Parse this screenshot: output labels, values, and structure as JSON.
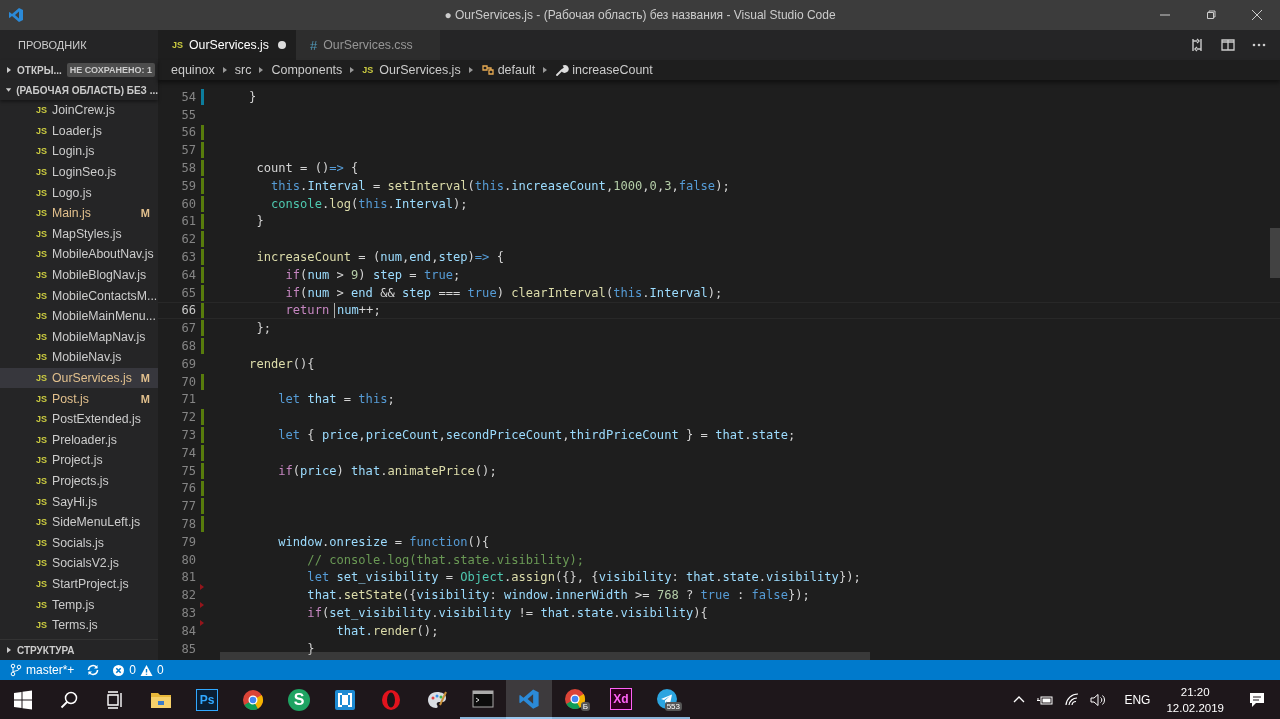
{
  "window": {
    "title": "● OurServices.js - (Рабочая область) без названия - Visual Studio Code"
  },
  "sidebar": {
    "title": "ПРОВОДНИК",
    "open_editors": {
      "label": "ОТКРЫ...",
      "badge": "НЕ СОХРАНЕНО: 1",
      "expanded": false
    },
    "workspace": {
      "label": "(РАБОЧАЯ ОБЛАСТЬ) БЕЗ ...",
      "expanded": true
    },
    "files": [
      {
        "icon": "JS",
        "name": "JoinCrew.js",
        "selected": false
      },
      {
        "icon": "JS",
        "name": "Loader.js",
        "selected": false
      },
      {
        "icon": "JS",
        "name": "Login.js",
        "selected": false
      },
      {
        "icon": "JS",
        "name": "LoginSeo.js",
        "selected": false
      },
      {
        "icon": "JS",
        "name": "Logo.js",
        "selected": false
      },
      {
        "icon": "JS",
        "name": "Main.js",
        "selected": false,
        "badge": "M"
      },
      {
        "icon": "JS",
        "name": "MapStyles.js",
        "selected": false
      },
      {
        "icon": "JS",
        "name": "MobileAboutNav.js",
        "selected": false
      },
      {
        "icon": "JS",
        "name": "MobileBlogNav.js",
        "selected": false
      },
      {
        "icon": "JS",
        "name": "MobileContactsM...",
        "selected": false
      },
      {
        "icon": "JS",
        "name": "MobileMainMenu...",
        "selected": false
      },
      {
        "icon": "JS",
        "name": "MobileMapNav.js",
        "selected": false
      },
      {
        "icon": "JS",
        "name": "MobileNav.js",
        "selected": false
      },
      {
        "icon": "JS",
        "name": "OurServices.js",
        "selected": true,
        "badge": "M"
      },
      {
        "icon": "JS",
        "name": "Post.js",
        "selected": false,
        "badge": "M"
      },
      {
        "icon": "JS",
        "name": "PostExtended.js",
        "selected": false
      },
      {
        "icon": "JS",
        "name": "Preloader.js",
        "selected": false
      },
      {
        "icon": "JS",
        "name": "Project.js",
        "selected": false
      },
      {
        "icon": "JS",
        "name": "Projects.js",
        "selected": false
      },
      {
        "icon": "JS",
        "name": "SayHi.js",
        "selected": false
      },
      {
        "icon": "JS",
        "name": "SideMenuLeft.js",
        "selected": false
      },
      {
        "icon": "JS",
        "name": "Socials.js",
        "selected": false
      },
      {
        "icon": "JS",
        "name": "SocialsV2.js",
        "selected": false
      },
      {
        "icon": "JS",
        "name": "StartProject.js",
        "selected": false
      },
      {
        "icon": "JS",
        "name": "Temp.js",
        "selected": false
      },
      {
        "icon": "JS",
        "name": "Terms.js",
        "selected": false
      }
    ],
    "outline": {
      "label": "СТРУКТУРА",
      "expanded": false
    }
  },
  "tabs": [
    {
      "icon": "JS",
      "label": "OurServices.js",
      "selected": true,
      "dirty": true
    },
    {
      "icon": "#",
      "label": "OurServices.css",
      "selected": false,
      "dirty": false
    }
  ],
  "breadcrumb": [
    {
      "kind": "folder",
      "text": "equinox"
    },
    {
      "kind": "folder",
      "text": "src"
    },
    {
      "kind": "folder",
      "text": "Components"
    },
    {
      "kind": "file",
      "icon": "JS",
      "text": "OurServices.js"
    },
    {
      "kind": "class",
      "text": "default"
    },
    {
      "kind": "method",
      "text": "increaseCount"
    }
  ],
  "editor": {
    "lines": [
      {
        "n": "54",
        "kind": "modified",
        "tokens": [
          {
            "t": "    }",
            "kind": "plain"
          }
        ]
      },
      {
        "n": "55",
        "kind": "plain"
      },
      {
        "n": "56",
        "kind": "added"
      },
      {
        "n": "57",
        "kind": "added"
      },
      {
        "n": "58",
        "kind": "added",
        "tokens": [
          {
            "t": "     count = ()",
            "kind": "plain"
          },
          {
            "t": "=>",
            "kind": "storage"
          },
          {
            "t": " {",
            "kind": "plain"
          }
        ]
      },
      {
        "n": "59",
        "kind": "added",
        "tokens": [
          {
            "t": "       this",
            "kind": "storage"
          },
          {
            "t": ".",
            "kind": "plain"
          },
          {
            "t": "Interval",
            "kind": "variable"
          },
          {
            "t": " = ",
            "kind": "plain"
          },
          {
            "t": "setInterval",
            "kind": "function"
          },
          {
            "t": "(",
            "kind": "plain"
          },
          {
            "t": "this",
            "kind": "storage"
          },
          {
            "t": ".",
            "kind": "plain"
          },
          {
            "t": "increaseCount",
            "kind": "variable"
          },
          {
            "t": ",",
            "kind": "plain"
          },
          {
            "t": "1000",
            "kind": "number"
          },
          {
            "t": ",",
            "kind": "plain"
          },
          {
            "t": "0",
            "kind": "number"
          },
          {
            "t": ",",
            "kind": "plain"
          },
          {
            "t": "3",
            "kind": "number"
          },
          {
            "t": ",",
            "kind": "plain"
          },
          {
            "t": "false",
            "kind": "storage"
          },
          {
            "t": ");",
            "kind": "plain"
          }
        ]
      },
      {
        "n": "60",
        "kind": "added",
        "tokens": [
          {
            "t": "       console",
            "kind": "type"
          },
          {
            "t": ".",
            "kind": "plain"
          },
          {
            "t": "log",
            "kind": "function"
          },
          {
            "t": "(",
            "kind": "plain"
          },
          {
            "t": "this",
            "kind": "storage"
          },
          {
            "t": ".",
            "kind": "plain"
          },
          {
            "t": "Interval",
            "kind": "variable"
          },
          {
            "t": ");",
            "kind": "plain"
          }
        ]
      },
      {
        "n": "61",
        "kind": "added",
        "tokens": [
          {
            "t": "     }",
            "kind": "plain"
          }
        ]
      },
      {
        "n": "62",
        "kind": "added"
      },
      {
        "n": "63",
        "kind": "added",
        "tokens": [
          {
            "t": "     increaseCount",
            "kind": "function"
          },
          {
            "t": " = (",
            "kind": "plain"
          },
          {
            "t": "num",
            "kind": "variable"
          },
          {
            "t": ",",
            "kind": "plain"
          },
          {
            "t": "end",
            "kind": "variable"
          },
          {
            "t": ",",
            "kind": "plain"
          },
          {
            "t": "step",
            "kind": "variable"
          },
          {
            "t": ")",
            "kind": "plain"
          },
          {
            "t": "=>",
            "kind": "storage"
          },
          {
            "t": " {",
            "kind": "plain"
          }
        ]
      },
      {
        "n": "64",
        "kind": "added",
        "tokens": [
          {
            "t": "         if",
            "kind": "keyword"
          },
          {
            "t": "(",
            "kind": "plain"
          },
          {
            "t": "num",
            "kind": "variable"
          },
          {
            "t": " > ",
            "kind": "plain"
          },
          {
            "t": "9",
            "kind": "number"
          },
          {
            "t": ") ",
            "kind": "plain"
          },
          {
            "t": "step",
            "kind": "variable"
          },
          {
            "t": " = ",
            "kind": "plain"
          },
          {
            "t": "true",
            "kind": "storage"
          },
          {
            "t": ";",
            "kind": "plain"
          }
        ]
      },
      {
        "n": "65",
        "kind": "added",
        "tokens": [
          {
            "t": "         if",
            "kind": "keyword"
          },
          {
            "t": "(",
            "kind": "plain"
          },
          {
            "t": "num",
            "kind": "variable"
          },
          {
            "t": " > ",
            "kind": "plain"
          },
          {
            "t": "end",
            "kind": "variable"
          },
          {
            "t": " && ",
            "kind": "plain"
          },
          {
            "t": "step",
            "kind": "variable"
          },
          {
            "t": " === ",
            "kind": "plain"
          },
          {
            "t": "true",
            "kind": "storage"
          },
          {
            "t": ") ",
            "kind": "plain"
          },
          {
            "t": "clearInterval",
            "kind": "function"
          },
          {
            "t": "(",
            "kind": "plain"
          },
          {
            "t": "this",
            "kind": "storage"
          },
          {
            "t": ".",
            "kind": "plain"
          },
          {
            "t": "Interval",
            "kind": "variable"
          },
          {
            "t": ");",
            "kind": "plain"
          }
        ]
      },
      {
        "n": "66",
        "kind": "added",
        "current": true,
        "tokens": [
          {
            "t": "         return ",
            "kind": "keyword"
          },
          {
            "kind": "cursor"
          },
          {
            "t": "num",
            "kind": "variable"
          },
          {
            "t": "++;",
            "kind": "plain"
          }
        ]
      },
      {
        "n": "67",
        "kind": "added",
        "tokens": [
          {
            "t": "     };",
            "kind": "plain"
          }
        ]
      },
      {
        "n": "68",
        "kind": "added"
      },
      {
        "n": "69",
        "kind": "plain",
        "tokens": [
          {
            "t": "    render",
            "kind": "function"
          },
          {
            "t": "(){",
            "kind": "plain"
          }
        ]
      },
      {
        "n": "70",
        "kind": "added"
      },
      {
        "n": "71",
        "kind": "plain",
        "tokens": [
          {
            "t": "        let ",
            "kind": "storage"
          },
          {
            "t": "that",
            "kind": "variable"
          },
          {
            "t": " = ",
            "kind": "plain"
          },
          {
            "t": "this",
            "kind": "storage"
          },
          {
            "t": ";",
            "kind": "plain"
          }
        ]
      },
      {
        "n": "72",
        "kind": "added"
      },
      {
        "n": "73",
        "kind": "added",
        "tokens": [
          {
            "t": "        let",
            "kind": "storage"
          },
          {
            "t": " { ",
            "kind": "plain"
          },
          {
            "t": "price",
            "kind": "variable"
          },
          {
            "t": ",",
            "kind": "plain"
          },
          {
            "t": "priceCount",
            "kind": "variable"
          },
          {
            "t": ",",
            "kind": "plain"
          },
          {
            "t": "secondPriceCount",
            "kind": "variable"
          },
          {
            "t": ",",
            "kind": "plain"
          },
          {
            "t": "thirdPriceCount",
            "kind": "variable"
          },
          {
            "t": " } = ",
            "kind": "plain"
          },
          {
            "t": "that",
            "kind": "variable"
          },
          {
            "t": ".",
            "kind": "plain"
          },
          {
            "t": "state",
            "kind": "variable"
          },
          {
            "t": ";",
            "kind": "plain"
          }
        ]
      },
      {
        "n": "74",
        "kind": "added"
      },
      {
        "n": "75",
        "kind": "added",
        "tokens": [
          {
            "t": "        if",
            "kind": "keyword"
          },
          {
            "t": "(",
            "kind": "plain"
          },
          {
            "t": "price",
            "kind": "variable"
          },
          {
            "t": ") ",
            "kind": "plain"
          },
          {
            "t": "that",
            "kind": "variable"
          },
          {
            "t": ".",
            "kind": "plain"
          },
          {
            "t": "animatePrice",
            "kind": "function"
          },
          {
            "t": "();",
            "kind": "plain"
          }
        ]
      },
      {
        "n": "76",
        "kind": "added"
      },
      {
        "n": "77",
        "kind": "added"
      },
      {
        "n": "78",
        "kind": "added"
      },
      {
        "n": "79",
        "kind": "plain",
        "tokens": [
          {
            "t": "        window",
            "kind": "variable"
          },
          {
            "t": ".",
            "kind": "plain"
          },
          {
            "t": "onresize",
            "kind": "variable"
          },
          {
            "t": " = ",
            "kind": "plain"
          },
          {
            "t": "function",
            "kind": "storage"
          },
          {
            "t": "(){",
            "kind": "plain"
          }
        ]
      },
      {
        "n": "80",
        "kind": "plain",
        "tokens": [
          {
            "t": "            // console.log(that.state.visibility);",
            "kind": "comment"
          }
        ]
      },
      {
        "n": "81",
        "kind": "plain",
        "tokens": [
          {
            "t": "            let ",
            "kind": "storage"
          },
          {
            "t": "set_visibility",
            "kind": "variable"
          },
          {
            "t": " = ",
            "kind": "plain"
          },
          {
            "t": "Object",
            "kind": "type"
          },
          {
            "t": ".",
            "kind": "plain"
          },
          {
            "t": "assign",
            "kind": "function"
          },
          {
            "t": "({}, {",
            "kind": "plain"
          },
          {
            "t": "visibility",
            "kind": "variable"
          },
          {
            "t": ": ",
            "kind": "plain"
          },
          {
            "t": "that",
            "kind": "variable"
          },
          {
            "t": ".",
            "kind": "plain"
          },
          {
            "t": "state",
            "kind": "variable"
          },
          {
            "t": ".",
            "kind": "plain"
          },
          {
            "t": "visibility",
            "kind": "variable"
          },
          {
            "t": "});",
            "kind": "plain"
          }
        ]
      },
      {
        "n": "82",
        "kind": "deleted",
        "tokens": [
          {
            "t": "            that",
            "kind": "variable"
          },
          {
            "t": ".",
            "kind": "plain"
          },
          {
            "t": "setState",
            "kind": "function"
          },
          {
            "t": "({",
            "kind": "plain"
          },
          {
            "t": "visibility",
            "kind": "variable"
          },
          {
            "t": ": ",
            "kind": "plain"
          },
          {
            "t": "window",
            "kind": "variable"
          },
          {
            "t": ".",
            "kind": "plain"
          },
          {
            "t": "innerWidth",
            "kind": "variable"
          },
          {
            "t": " >= ",
            "kind": "plain"
          },
          {
            "t": "768",
            "kind": "number"
          },
          {
            "t": " ? ",
            "kind": "plain"
          },
          {
            "t": "true",
            "kind": "storage"
          },
          {
            "t": " : ",
            "kind": "plain"
          },
          {
            "t": "false",
            "kind": "storage"
          },
          {
            "t": "});",
            "kind": "plain"
          }
        ]
      },
      {
        "n": "83",
        "kind": "deleted",
        "tokens": [
          {
            "t": "            if",
            "kind": "keyword"
          },
          {
            "t": "(",
            "kind": "plain"
          },
          {
            "t": "set_visibility",
            "kind": "variable"
          },
          {
            "t": ".",
            "kind": "plain"
          },
          {
            "t": "visibility",
            "kind": "variable"
          },
          {
            "t": " != ",
            "kind": "plain"
          },
          {
            "t": "that",
            "kind": "variable"
          },
          {
            "t": ".",
            "kind": "plain"
          },
          {
            "t": "state",
            "kind": "variable"
          },
          {
            "t": ".",
            "kind": "plain"
          },
          {
            "t": "visibility",
            "kind": "variable"
          },
          {
            "t": "){",
            "kind": "plain"
          }
        ]
      },
      {
        "n": "84",
        "kind": "deleted",
        "tokens": [
          {
            "t": "                that.",
            "kind": "variable"
          },
          {
            "t": "render",
            "kind": "function"
          },
          {
            "t": "();",
            "kind": "plain"
          }
        ]
      },
      {
        "n": "85",
        "kind": "plain",
        "tokens": [
          {
            "t": "            }",
            "kind": "plain"
          }
        ]
      }
    ]
  },
  "status_bar": {
    "branch": "master*+",
    "errors": "0",
    "warnings": "0"
  },
  "taskbar": {
    "apps": [
      {
        "kind": "start",
        "running": false,
        "active": false
      },
      {
        "kind": "search",
        "running": false,
        "active": false
      },
      {
        "kind": "taskview",
        "running": false,
        "active": false
      },
      {
        "kind": "folder",
        "running": false,
        "active": false
      },
      {
        "kind": "ps",
        "text": "Ps",
        "running": false,
        "active": false
      },
      {
        "kind": "chrome",
        "running": false,
        "active": false
      },
      {
        "kind": "s",
        "text": "S",
        "running": false,
        "active": false
      },
      {
        "kind": "brackets",
        "running": false,
        "active": false
      },
      {
        "kind": "opera",
        "running": false,
        "active": false
      },
      {
        "kind": "paint",
        "running": false,
        "active": false
      },
      {
        "kind": "terminal",
        "running": true,
        "active": false
      },
      {
        "kind": "vscode",
        "running": true,
        "active": true
      },
      {
        "kind": "chrome",
        "badge": "Б",
        "running": true,
        "active": false
      },
      {
        "kind": "xd",
        "text": "Xd",
        "running": true,
        "active": false
      },
      {
        "kind": "telegram",
        "badge": "553",
        "running": true,
        "active": false
      }
    ],
    "language": "ENG",
    "time": "21:20",
    "date": "12.02.2019"
  }
}
